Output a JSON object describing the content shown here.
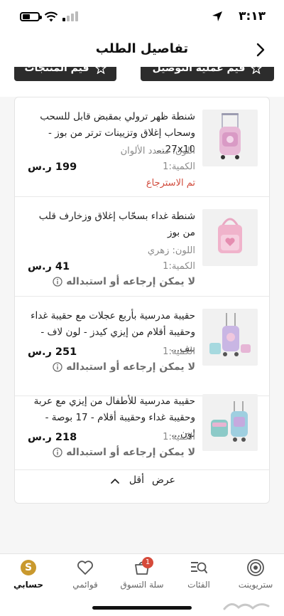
{
  "status_bar": {
    "time": "٣:١٣"
  },
  "header": {
    "title": "تفاصيل الطلب"
  },
  "rate_buttons": [
    {
      "label": "قيم عملية التوصيل"
    },
    {
      "label": "قيم المنتجات"
    }
  ],
  "items": [
    {
      "title": "شنطة ظهر ترولي بمقبض قابل للسحب وسحاب إغلاق وتزيينات ترتر من بوز - 27x10...",
      "color": "اللون: متعدد الألوان",
      "quantity": "الكمية:1",
      "price": "199 ر.س",
      "status": "تم الاسترجاع",
      "status_type": "returned"
    },
    {
      "title": "شنطة غداء بسحّاب إغلاق وزخارف قلب من بوز",
      "color": "اللون: زهري",
      "quantity": "الكمية:1",
      "price": "41 ر.س",
      "status": "لا يمكن إرجاعه أو استبداله",
      "status_type": "non_returnable"
    },
    {
      "title": "حقيبة مدرسية بأربع عجلات مع حقيبة غداء وحقيبة أقلام من إيزي كيدز - لون لاف - بنف...",
      "color": "",
      "quantity": "الكمية:1",
      "price": "251 ر.س",
      "status": "لا يمكن إرجاعه أو استبداله",
      "status_type": "non_returnable"
    },
    {
      "title": "حقيبة مدرسية للأطفال من إيزي مع عربة وحقيبة غداء وحقيبة أقلام - 17 بوصة - لون...",
      "color": "",
      "quantity": "الكمية:1",
      "price": "218 ر.س",
      "status": "لا يمكن إرجاعه أو استبداله",
      "status_type": "non_returnable"
    }
  ],
  "view_toggle": {
    "view": "عرض",
    "less": "أقل"
  },
  "bottom_nav": [
    {
      "label": "ستريوينت",
      "icon": "target-icon"
    },
    {
      "label": "الفئات",
      "icon": "categories-search-icon"
    },
    {
      "label": "سلة التسوق",
      "icon": "cart-icon",
      "badge": "1"
    },
    {
      "label": "قوائمي",
      "icon": "heart-icon"
    },
    {
      "label": "حسابي",
      "icon": "account-icon",
      "active": true,
      "avatar_letter": "S"
    }
  ],
  "colors": {
    "accent_red": "#d14b3c",
    "dark_button": "#2c2c2c",
    "account_gold": "#c9992e"
  }
}
